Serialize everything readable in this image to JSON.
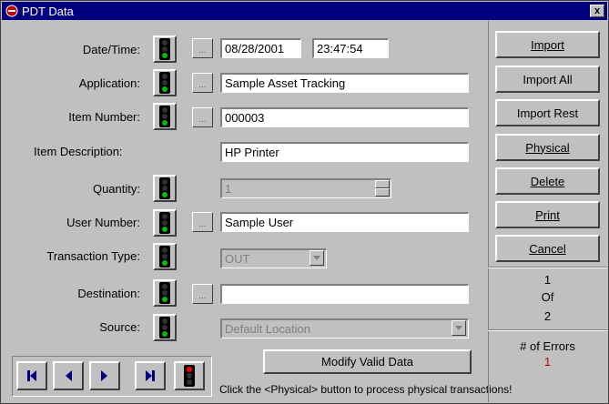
{
  "window": {
    "title": "PDT Data",
    "close_label": "x"
  },
  "form": {
    "date_time_label": "Date/Time:",
    "date_value": "08/28/2001",
    "time_value": "23:47:54",
    "application_label": "Application:",
    "application_value": "Sample Asset Tracking",
    "item_number_label": "Item Number:",
    "item_number_value": "000003",
    "item_description_label": "Item Description:",
    "item_description_value": "HP Printer",
    "quantity_label": "Quantity:",
    "quantity_value": "1",
    "user_number_label": "User Number:",
    "user_number_value": "Sample User",
    "transaction_type_label": "Transaction Type:",
    "transaction_type_value": "OUT",
    "destination_label": "Destination:",
    "destination_value": "",
    "source_label": "Source:",
    "source_value": "Default Location",
    "dots_label": "..."
  },
  "actions": {
    "import_label": "Import",
    "import_all_label": "Import All",
    "import_rest_label": "Import Rest",
    "physical_label": "Physical",
    "delete_label": "Delete",
    "print_label": "Print",
    "cancel_label": "Cancel",
    "modify_label": "Modify Valid Data"
  },
  "record": {
    "current": "1",
    "of_label": "Of",
    "total": "2"
  },
  "errors": {
    "label": "# of Errors",
    "count": "1",
    "count_color": "#c00000"
  },
  "hint": "Click the <Physical> button to process physical transactions!",
  "icons": {
    "traffic_light_field": "traffic-light-green-icon",
    "traffic_light_nav": "traffic-light-red-icon",
    "nav_first": "first-record-icon",
    "nav_prev": "previous-record-icon",
    "nav_next": "next-record-icon",
    "nav_last": "last-record-icon"
  },
  "colors": {
    "titlebar": "#000080",
    "window_bg": "#c0c0c0",
    "nav_arrow": "#000080",
    "light_green": "#00c000",
    "light_red": "#ff0000"
  }
}
